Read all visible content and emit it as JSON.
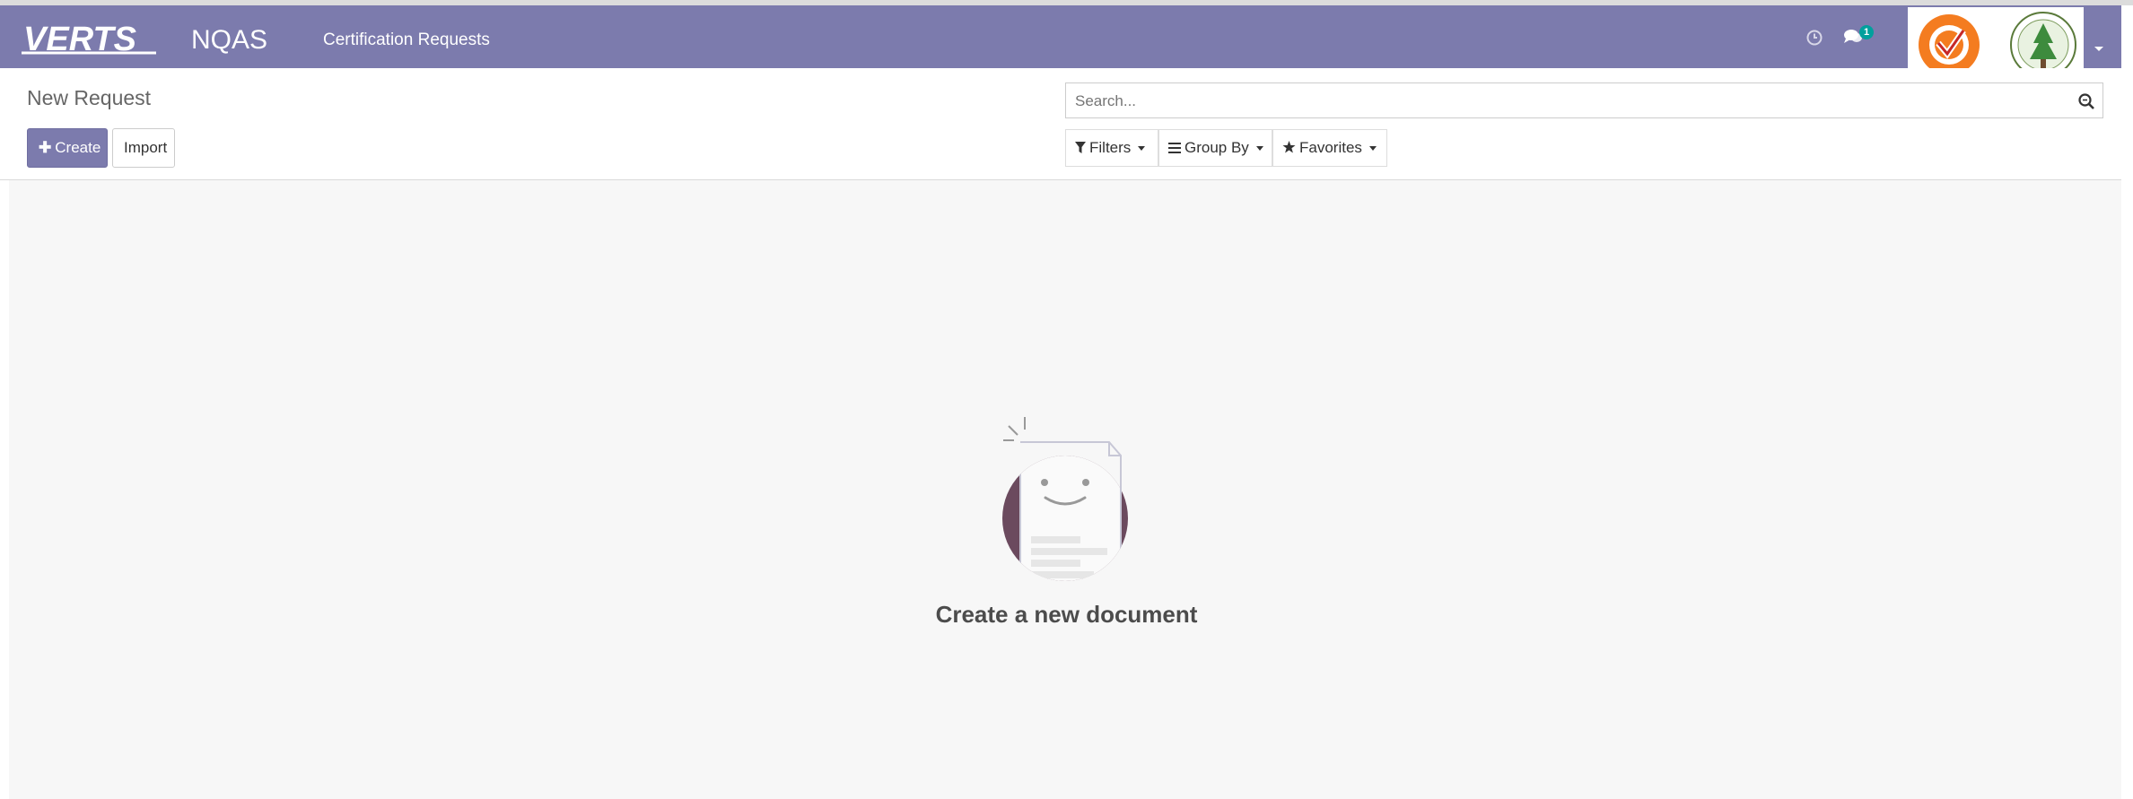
{
  "navbar": {
    "brand_logo_text": "VERTS",
    "app_name": "NQAS",
    "menu_item": "Certification Requests",
    "message_count": "1",
    "company_logos": [
      "orange-checkmark-emblem",
      "green-tree-seal"
    ],
    "icons": [
      "clock-icon",
      "chat-icon",
      "user-caret-icon"
    ]
  },
  "control_panel": {
    "breadcrumb": "New Request",
    "create_label": "Create",
    "import_label": "Import",
    "search_placeholder": "Search...",
    "filters_label": "Filters",
    "group_by_label": "Group By",
    "favorites_label": "Favorites"
  },
  "empty_state": {
    "title": "Create a new document",
    "illustration": "smiling-document"
  },
  "colors": {
    "navbar": "#7c7bad",
    "primary_button": "#7c7bad",
    "content_bg": "#f7f7f7",
    "badge": "#00a09d",
    "illustration_circle": "#6b4a5e"
  }
}
